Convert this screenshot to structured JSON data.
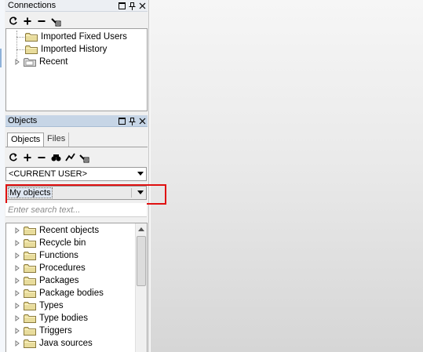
{
  "connections_panel": {
    "title": "Connections",
    "toolbar_icons": [
      "refresh-icon",
      "add-icon",
      "remove-icon",
      "properties-icon"
    ],
    "items": [
      {
        "label": "Imported Fixed Users",
        "expandable": false
      },
      {
        "label": "Imported History",
        "expandable": false
      },
      {
        "label": "Recent",
        "expandable": true
      }
    ]
  },
  "objects_panel": {
    "title": "Objects",
    "tabs": [
      {
        "label": "Objects",
        "active": true
      },
      {
        "label": "Files",
        "active": false
      }
    ],
    "toolbar_icons": [
      "refresh-icon",
      "add-icon",
      "remove-icon",
      "find-icon",
      "filter-icon",
      "properties-icon"
    ],
    "user_select": {
      "value": "<CURRENT USER>"
    },
    "filter_select": {
      "value": "My objects"
    },
    "search": {
      "placeholder": "Enter search text..."
    },
    "items": [
      {
        "label": "Recent objects"
      },
      {
        "label": "Recycle bin"
      },
      {
        "label": "Functions"
      },
      {
        "label": "Procedures"
      },
      {
        "label": "Packages"
      },
      {
        "label": "Package bodies"
      },
      {
        "label": "Types"
      },
      {
        "label": "Type bodies"
      },
      {
        "label": "Triggers"
      },
      {
        "label": "Java sources"
      }
    ]
  },
  "colors": {
    "highlight_border": "#e01010",
    "active_title": "#c6d5e6",
    "folder_fill": "#e8dc9c"
  }
}
